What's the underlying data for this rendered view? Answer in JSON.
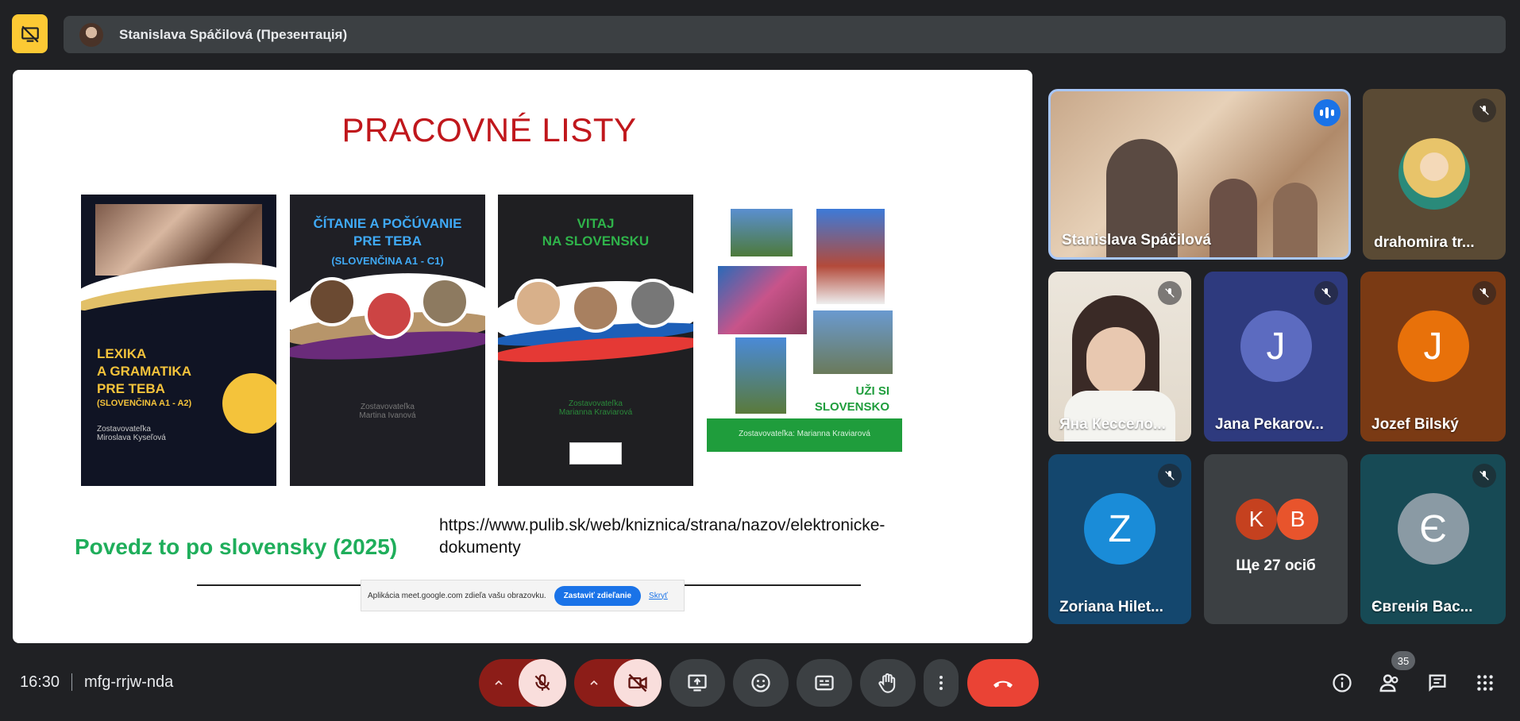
{
  "header": {
    "presenter_title": "Stanislava Spáčilová (Презентація)"
  },
  "slide": {
    "title": "PRACOVNÉ LISTY",
    "books": [
      {
        "title": "LEXIKA\nA GRAMATIKA\nPRE TEBA",
        "subtitle": "(SLOVENČINA A1 - A2)",
        "author": "Zostavovateľka\nMiroslava Kyseľová"
      },
      {
        "title": "ČÍTANIE A POČÚVANIE\nPRE TEBA",
        "subtitle": "(SLOVENČINA A1 - C1)",
        "author": "Zostavovateľka\nMartina Ivanová"
      },
      {
        "title": "VITAJ\nNA SLOVENSKU",
        "subtitle": "",
        "author": "Zostavovateľka\nMarianna Kraviarová"
      },
      {
        "title": "UŽI SI\nSLOVENSKO",
        "subtitle": "",
        "author": "Zostavovateľka: Marianna Kraviarová"
      }
    ],
    "footer_title": "Povedz to po slovensky (2025)",
    "url": "https://www.pulib.sk/web/kniznica/strana/nazov/elektronicke-dokumenty",
    "share_notice": "Aplikácia meet.google.com zdieľa vašu obrazovku.",
    "stop_sharing": "Zastaviť zdieľanie",
    "hide": "Skryť"
  },
  "participants": [
    {
      "name": "Stanislava Spáčilová",
      "state": "speaking"
    },
    {
      "name": "drahomira tr...",
      "state": "muted"
    },
    {
      "name": "Яна Кессело...",
      "state": "muted"
    },
    {
      "name": "Jana Pekarov...",
      "initial": "J",
      "color": "#5c6bc0",
      "state": "muted"
    },
    {
      "name": "Jozef Bilský",
      "initial": "J",
      "color": "#e8710a",
      "state": "muted"
    },
    {
      "name": "Zoriana Hilet...",
      "initial": "Z",
      "color": "#1a8cd8",
      "state": "muted"
    },
    {
      "name": "Ще 27 осіб",
      "initials": [
        "K",
        "B"
      ],
      "colors": [
        "#c5411f",
        "#e8542c"
      ]
    },
    {
      "name": "Євгенія Вас...",
      "initial": "Є",
      "color": "#8a9aa4",
      "state": "muted"
    }
  ],
  "bottom_bar": {
    "time": "16:30",
    "meeting_code": "mfg-rrjw-nda",
    "people_count": "35",
    "controls": [
      "mic-off-icon",
      "camera-off-icon",
      "present-icon",
      "emoji-icon",
      "captions-icon",
      "raise-hand-icon",
      "more-icon",
      "end-call-icon"
    ]
  },
  "colors": {
    "accent_yellow": "#fcc934",
    "end_call_red": "#ea4335",
    "muted_red": "#f9dedc"
  }
}
